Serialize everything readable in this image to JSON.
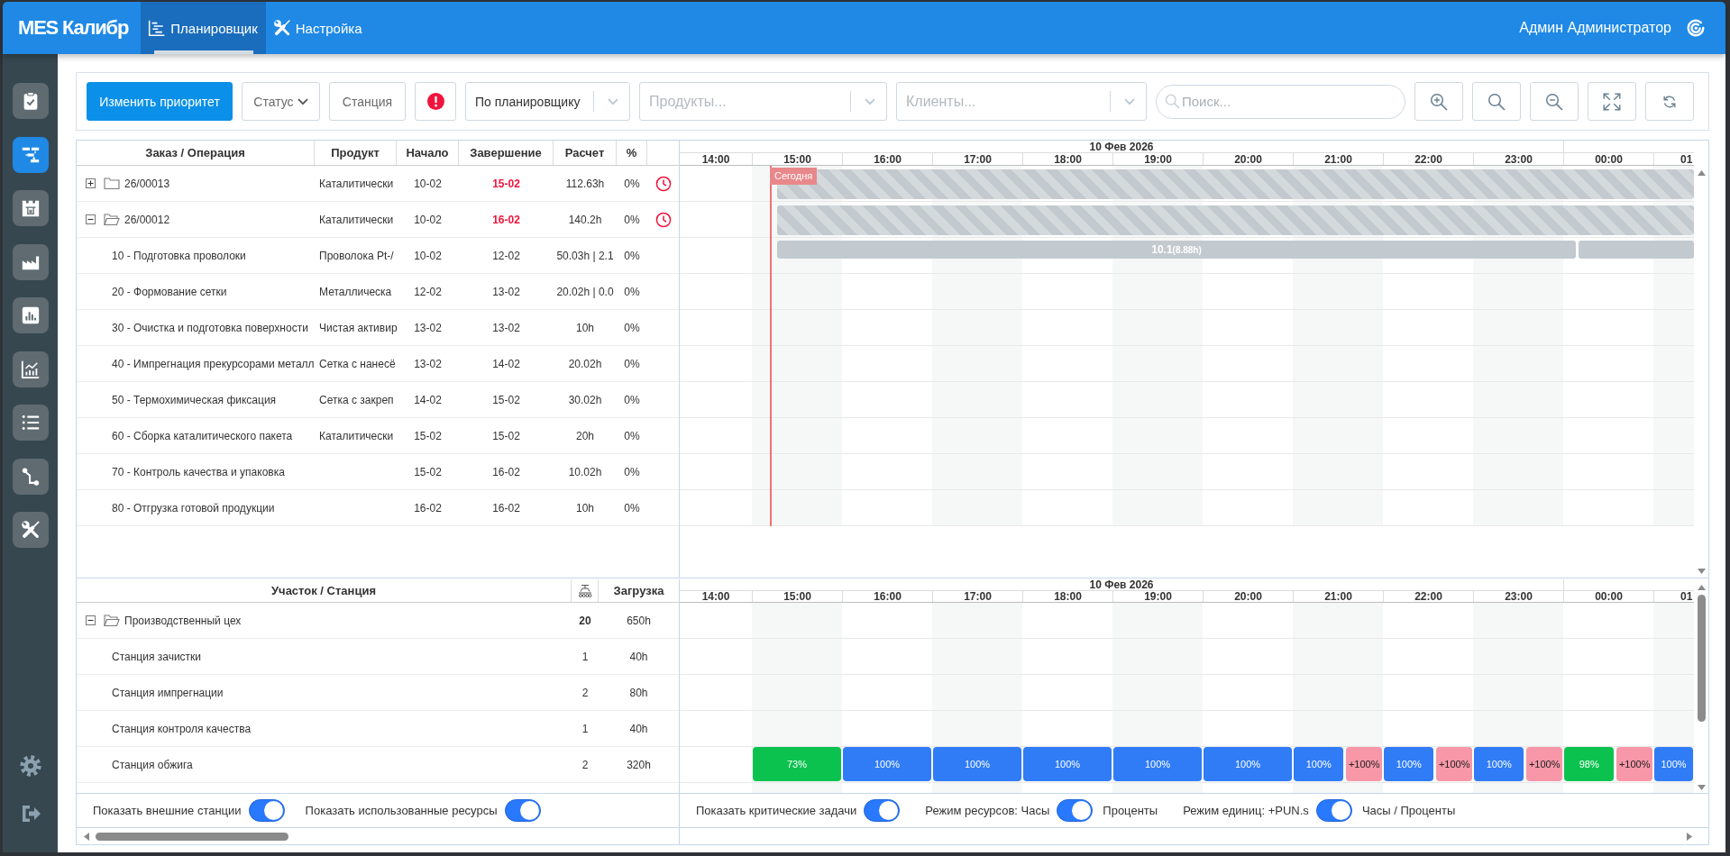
{
  "header": {
    "logo": "MES Калибр",
    "tabs": [
      {
        "label": "Планировщик",
        "selected": true
      },
      {
        "label": "Настройка",
        "selected": false
      }
    ],
    "user": "Админ Администратор"
  },
  "sidebar": {
    "items": [
      {
        "selected": false
      },
      {
        "selected": true
      },
      {
        "selected": false
      },
      {
        "selected": false
      },
      {
        "selected": false
      },
      {
        "selected": false
      },
      {
        "selected": false
      },
      {
        "selected": false
      },
      {
        "selected": false
      }
    ]
  },
  "toolbar": {
    "priority_button": "Изменить приоритет",
    "status_filter": "Статус",
    "station_button": "Станция",
    "planner_select": {
      "value": "По планировщику"
    },
    "products_select": {
      "placeholder": "Продукты..."
    },
    "clients_select": {
      "placeholder": "Клиенты..."
    },
    "search": {
      "placeholder": "Поиск..."
    }
  },
  "orders": {
    "columns": [
      "Заказ / Операция",
      "Продукт",
      "Начало",
      "Завершение",
      "Расчет",
      "%"
    ],
    "rows": [
      {
        "label": "26/00013",
        "product": "Каталитически",
        "start": "10-02",
        "end": "15-02",
        "calc": "112.63h",
        "percent": "0%",
        "late": true,
        "expanded": false,
        "bars": [
          {
            "kind": "summary"
          }
        ]
      },
      {
        "label": "26/00012",
        "product": "Каталитически",
        "start": "10-02",
        "end": "16-02",
        "calc": "140.2h",
        "percent": "0%",
        "late": true,
        "expanded": true,
        "bars": [
          {
            "kind": "summary"
          }
        ],
        "children": [
          {
            "label": "10 - Подготовка проволоки",
            "product": "Проволока Pt-/",
            "start": "10-02",
            "end": "12-02",
            "calc": "50.03h | 2.1",
            "percent": "0%",
            "late": false,
            "bars": [
              {
                "kind": "operation",
                "label": "10.1",
                "note": "(8.88h)"
              },
              {
                "kind": "operation"
              }
            ]
          },
          {
            "label": "20 - Формование сетки",
            "product": "Металлическа",
            "start": "12-02",
            "end": "13-02",
            "calc": "20.02h | 0.0",
            "percent": "0%",
            "late": false
          },
          {
            "label": "30 - Очистка и подготовка поверхности",
            "product": "Чистая активир",
            "start": "13-02",
            "end": "13-02",
            "calc": "10h",
            "percent": "0%",
            "late": false
          },
          {
            "label": "40 - Импрегнация прекурсорами металл",
            "product": "Сетка с нанесё",
            "start": "13-02",
            "end": "14-02",
            "calc": "20.02h",
            "percent": "0%",
            "late": false
          },
          {
            "label": "50 - Термохимическая фиксация",
            "product": "Сетка с закреп",
            "start": "14-02",
            "end": "15-02",
            "calc": "30.02h",
            "percent": "0%",
            "late": false
          },
          {
            "label": "60 - Сборка каталитического пакета",
            "product": "Каталитически",
            "start": "15-02",
            "end": "15-02",
            "calc": "20h",
            "percent": "0%",
            "late": false
          },
          {
            "label": "70 - Контроль качества и упаковка",
            "start": "15-02",
            "end": "16-02",
            "calc": "10.02h",
            "percent": "0%",
            "late": false
          },
          {
            "label": "80 - Отгрузка готовой продукции",
            "start": "16-02",
            "end": "16-02",
            "calc": "10h",
            "percent": "0%",
            "late": false
          }
        ]
      }
    ],
    "timeline": {
      "date": "10 Фев 2026",
      "hours": [
        "14:00",
        "15:00",
        "16:00",
        "17:00",
        "18:00",
        "19:00",
        "20:00",
        "21:00",
        "22:00",
        "23:00",
        "00:00",
        "01"
      ],
      "today_label": "Сегодня"
    }
  },
  "stations": {
    "columns": [
      {
        "kind": "text",
        "label": "Участок / Станция"
      },
      {
        "kind": "icon"
      },
      {
        "kind": "text",
        "label": "Загрузка"
      }
    ],
    "rows": [
      {
        "label": "Производственный цех",
        "count": "20",
        "load": "650h",
        "expanded": true,
        "children": [
          {
            "label": "Станция зачистки",
            "count": "1",
            "load": "40h"
          },
          {
            "label": "Станция импрегнации",
            "count": "2",
            "load": "80h"
          },
          {
            "label": "Станция контроля качества",
            "count": "1",
            "load": "40h"
          },
          {
            "label": "Станция обжига",
            "count": "2",
            "load": "320h",
            "bars": [
              {
                "kind": "hour",
                "label": "73%",
                "color": "#0cc24f"
              },
              {
                "kind": "hour",
                "label": "100%",
                "color": "#2f7cf6"
              },
              {
                "kind": "hour",
                "label": "100%",
                "color": "#2f7cf6"
              },
              {
                "kind": "hour",
                "label": "100%",
                "color": "#2f7cf6"
              },
              {
                "kind": "hour",
                "label": "100%",
                "color": "#2f7cf6"
              },
              {
                "kind": "hour",
                "label": "100%",
                "color": "#2f7cf6"
              },
              {
                "kind": "base",
                "label": "100%",
                "color": "#2f7cf6"
              },
              {
                "kind": "over",
                "label": "+100%",
                "color": "#f797a8"
              },
              {
                "kind": "base",
                "label": "100%",
                "color": "#2f7cf6"
              },
              {
                "kind": "over",
                "label": "+100%",
                "color": "#f797a8"
              },
              {
                "kind": "base",
                "label": "100%",
                "color": "#2f7cf6"
              },
              {
                "kind": "over",
                "label": "+100%",
                "color": "#f797a8"
              },
              {
                "kind": "base",
                "label": "98%",
                "color": "#0cc24f"
              },
              {
                "kind": "over",
                "label": "+100%",
                "color": "#f797a8"
              },
              {
                "kind": "base",
                "label": "100%",
                "color": "#2f7cf6"
              }
            ]
          }
        ]
      }
    ],
    "timeline": {
      "date": "10 Фев 2026",
      "hours": [
        "14:00",
        "15:00",
        "16:00",
        "17:00",
        "18:00",
        "19:00",
        "20:00",
        "21:00",
        "22:00",
        "23:00",
        "00:00",
        "01"
      ]
    }
  },
  "options_left": [
    {
      "label": "Показать внешние станции",
      "on": true
    },
    {
      "label": "Показать использованные ресурсы",
      "on": true
    }
  ],
  "options_right": [
    {
      "label": "Показать критические задачи",
      "on": true
    },
    {
      "label": "Режим ресурсов: Часы",
      "on": true,
      "after": "Проценты"
    },
    {
      "label": "Режим единиц: +PUN.s",
      "on": true,
      "after": "Часы / Проценты"
    }
  ]
}
